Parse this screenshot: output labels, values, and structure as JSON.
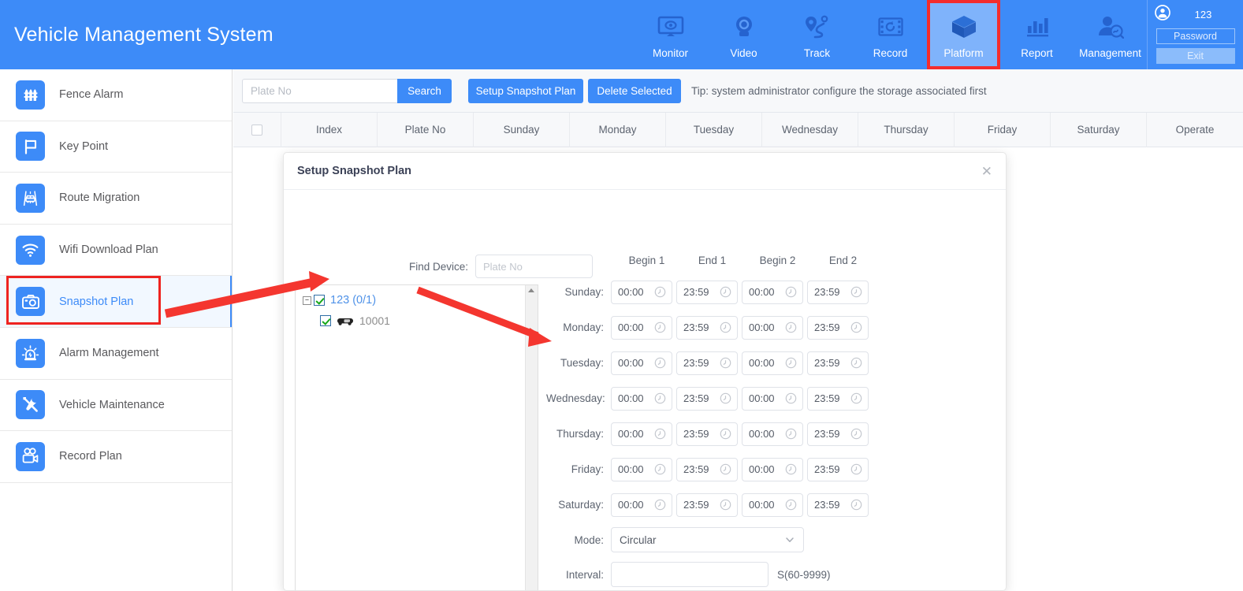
{
  "header": {
    "app_title": "Vehicle Management System",
    "nav": [
      {
        "label": "Monitor",
        "icon": "monitor-icon",
        "active": false
      },
      {
        "label": "Video",
        "icon": "camera-icon",
        "active": false
      },
      {
        "label": "Track",
        "icon": "track-pin-icon",
        "active": false
      },
      {
        "label": "Record",
        "icon": "film-record-icon",
        "active": false
      },
      {
        "label": "Platform",
        "icon": "cube-icon",
        "active": true
      },
      {
        "label": "Report",
        "icon": "bar-chart-icon",
        "active": false
      },
      {
        "label": "Management",
        "icon": "user-search-icon",
        "active": false
      }
    ],
    "user": {
      "name": "123",
      "avatar_icon": "user-circle-icon",
      "password_label": "Password",
      "exit_label": "Exit"
    },
    "accent_color": "#3d8bf8",
    "active_nav_color": "#7fb3fb",
    "highlight_color": "#ee2320"
  },
  "sidebar": {
    "items": [
      {
        "label": "Fence Alarm",
        "icon": "fence-icon",
        "active": false
      },
      {
        "label": "Key Point",
        "icon": "flag-icon",
        "active": false
      },
      {
        "label": "Route Migration",
        "icon": "car-road-icon",
        "active": false
      },
      {
        "label": "Wifi Download Plan",
        "icon": "wifi-icon",
        "active": false
      },
      {
        "label": "Snapshot Plan",
        "icon": "camera-photo-icon",
        "active": true
      },
      {
        "label": "Alarm Management",
        "icon": "siren-icon",
        "active": false
      },
      {
        "label": "Vehicle Maintenance",
        "icon": "tools-icon",
        "active": false
      },
      {
        "label": "Record Plan",
        "icon": "video-camera-icon",
        "active": false
      }
    ]
  },
  "toolbar": {
    "plate_placeholder": "Plate No",
    "plate_value": "",
    "search_label": "Search",
    "setup_label": "Setup Snapshot Plan",
    "delete_label": "Delete Selected",
    "tip": "Tip: system administrator configure the storage associated first"
  },
  "table": {
    "columns": [
      "Index",
      "Plate No",
      "Sunday",
      "Monday",
      "Tuesday",
      "Wednesday",
      "Thursday",
      "Friday",
      "Saturday",
      "Operate"
    ],
    "rows": []
  },
  "modal": {
    "title": "Setup Snapshot Plan",
    "close_icon": "close-icon",
    "find_device_label": "Find Device:",
    "find_device_placeholder": "Plate No",
    "find_device_value": "",
    "tree": {
      "root": {
        "label": "123 (0/1)",
        "checked": true,
        "expanded": true
      },
      "children": [
        {
          "label": "10001",
          "checked": true,
          "icon": "car-icon"
        }
      ]
    },
    "schedule": {
      "headers": [
        "Begin 1",
        "End 1",
        "Begin 2",
        "End 2"
      ],
      "rows": [
        {
          "day": "Sunday:",
          "times": [
            "00:00",
            "23:59",
            "00:00",
            "23:59"
          ]
        },
        {
          "day": "Monday:",
          "times": [
            "00:00",
            "23:59",
            "00:00",
            "23:59"
          ]
        },
        {
          "day": "Tuesday:",
          "times": [
            "00:00",
            "23:59",
            "00:00",
            "23:59"
          ]
        },
        {
          "day": "Wednesday:",
          "times": [
            "00:00",
            "23:59",
            "00:00",
            "23:59"
          ]
        },
        {
          "day": "Thursday:",
          "times": [
            "00:00",
            "23:59",
            "00:00",
            "23:59"
          ]
        },
        {
          "day": "Friday:",
          "times": [
            "00:00",
            "23:59",
            "00:00",
            "23:59"
          ]
        },
        {
          "day": "Saturday:",
          "times": [
            "00:00",
            "23:59",
            "00:00",
            "23:59"
          ]
        }
      ]
    },
    "mode_label": "Mode:",
    "mode_value": "Circular",
    "mode_options": [
      "Circular"
    ],
    "interval_label": "Interval:",
    "interval_value": "",
    "interval_unit": "S(60-9999)"
  },
  "annotations": {
    "platform_box_color": "#f42c2c",
    "snapshot_box_color": "#ee2320",
    "arrow_color": "#f4362f"
  }
}
